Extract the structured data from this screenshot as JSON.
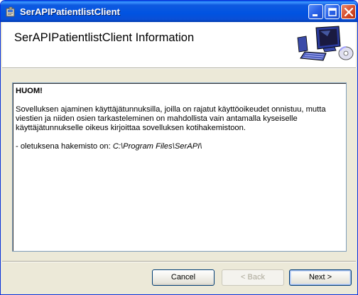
{
  "window": {
    "title": "SerAPIPatientlistClient",
    "icon": "installer-icon"
  },
  "titlebar_buttons": {
    "minimize": "minimize-icon",
    "maximize": "maximize-icon",
    "close": "close-icon"
  },
  "header": {
    "title": "SerAPIPatientlistClient Information",
    "logo": "computer-setup-icon"
  },
  "content": {
    "heading": "HUOM!",
    "paragraph1": "Sovelluksen ajaminen käyttäjätunnuksilla, joilla on rajatut käyttöoikeudet onnistuu, mutta viestien ja niiden osien tarkasteleminen on mahdollista vain antamalla kyseiselle käyttäjätunnukselle oikeus kirjoittaa sovelluksen kotihakemistoon.",
    "default_dir_prefix": "- oletuksena hakemisto on: ",
    "default_dir_path": "C:\\Program Files\\SerAPI\\"
  },
  "buttons": {
    "cancel": "Cancel",
    "back": "< Back",
    "next": "Next >"
  }
}
